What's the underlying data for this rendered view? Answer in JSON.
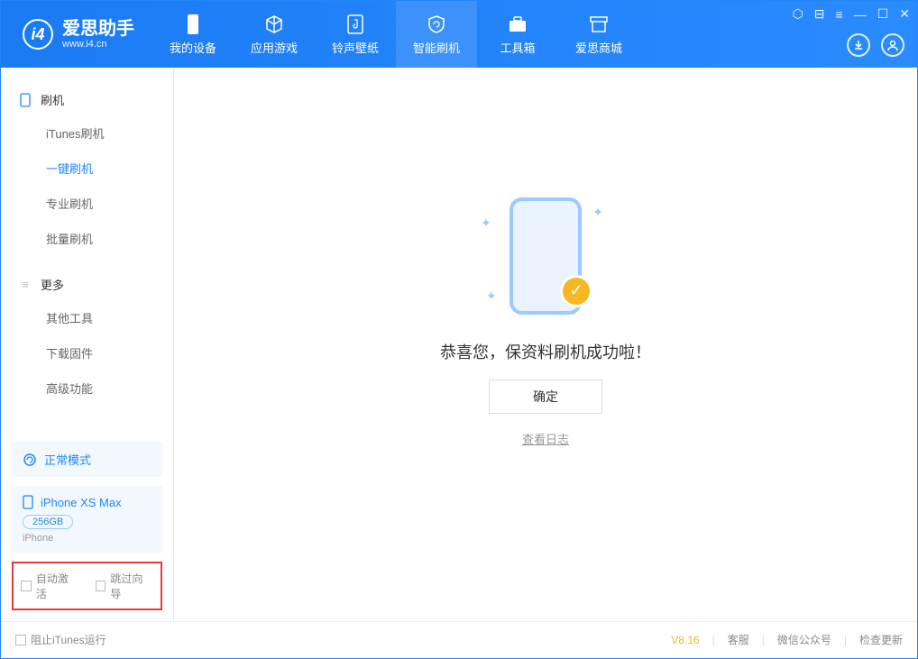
{
  "app": {
    "name": "爱思助手",
    "url": "www.i4.cn"
  },
  "nav": {
    "tabs": [
      {
        "label": "我的设备"
      },
      {
        "label": "应用游戏"
      },
      {
        "label": "铃声壁纸"
      },
      {
        "label": "智能刷机"
      },
      {
        "label": "工具箱"
      },
      {
        "label": "爱思商城"
      }
    ]
  },
  "sidebar": {
    "section1_title": "刷机",
    "flash_items": [
      {
        "label": "iTunes刷机"
      },
      {
        "label": "一键刷机"
      },
      {
        "label": "专业刷机"
      },
      {
        "label": "批量刷机"
      }
    ],
    "section2_title": "更多",
    "more_items": [
      {
        "label": "其他工具"
      },
      {
        "label": "下载固件"
      },
      {
        "label": "高级功能"
      }
    ]
  },
  "device": {
    "mode": "正常模式",
    "name": "iPhone XS Max",
    "storage": "256GB",
    "type": "iPhone"
  },
  "options": {
    "auto_activate": "自动激活",
    "skip_guide": "跳过向导"
  },
  "main": {
    "success_text": "恭喜您，保资料刷机成功啦！",
    "ok_button": "确定",
    "log_link": "查看日志"
  },
  "footer": {
    "block_itunes": "阻止iTunes运行",
    "version": "V8.16",
    "links": [
      "客服",
      "微信公众号",
      "检查更新"
    ]
  }
}
